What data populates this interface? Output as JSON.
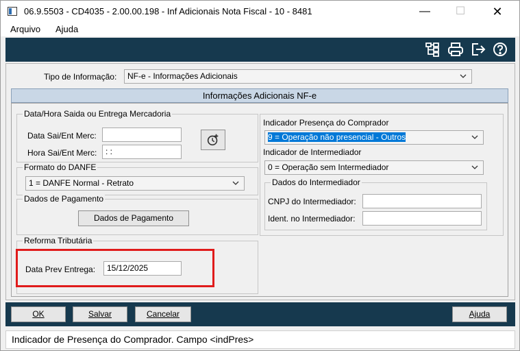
{
  "window": {
    "title": "06.9.5503 - CD4035 - 2.00.00.198 - Inf Adicionais Nota Fiscal - 10 - 8481",
    "minimize": "—",
    "maximize": "☐",
    "close": "✕"
  },
  "menu": {
    "arquivo": "Arquivo",
    "ajuda": "Ajuda"
  },
  "toolbar": {
    "icons": [
      "tree-structure-icon",
      "printer-icon",
      "exit-icon",
      "help-icon"
    ]
  },
  "tipo_informacao": {
    "label": "Tipo de Informação:",
    "value": "NF-e - Informações Adicionais"
  },
  "section": {
    "title": "Informações Adicionais NF-e"
  },
  "data_hora": {
    "group_title": "Data/Hora Saida ou Entrega Mercadoria",
    "data_label": "Data Sai/Ent Merc:",
    "data_value": "",
    "hora_label": "Hora Sai/Ent Merc:",
    "hora_value": " :  :"
  },
  "formato_danfe": {
    "group_title": "Formato do DANFE",
    "value": "1 = DANFE Normal - Retrato"
  },
  "pagamento": {
    "group_title": "Dados de Pagamento",
    "button": "Dados de Pagamento"
  },
  "reforma": {
    "group_title": "Reforma Tributária",
    "label": "Data Prev Entrega:",
    "value": "15/12/2025"
  },
  "presenca": {
    "label": "Indicador Presença do Comprador",
    "value": "9 = Operação não presencial - Outros"
  },
  "intermediador": {
    "label": "Indicador de Intermediador",
    "value": "0 = Operação sem Intermediador"
  },
  "dados_intermediador": {
    "group_title": "Dados do Intermediador",
    "cnpj_label": "CNPJ do Intermediador:",
    "cnpj_value": "",
    "ident_label": "Ident. no Intermediador:",
    "ident_value": ""
  },
  "buttons": {
    "ok": "OK",
    "salvar": "Salvar",
    "cancelar": "Cancelar",
    "ajuda": "Ajuda"
  },
  "status": {
    "text": "Indicador de Presença do Comprador. Campo <indPres>"
  }
}
